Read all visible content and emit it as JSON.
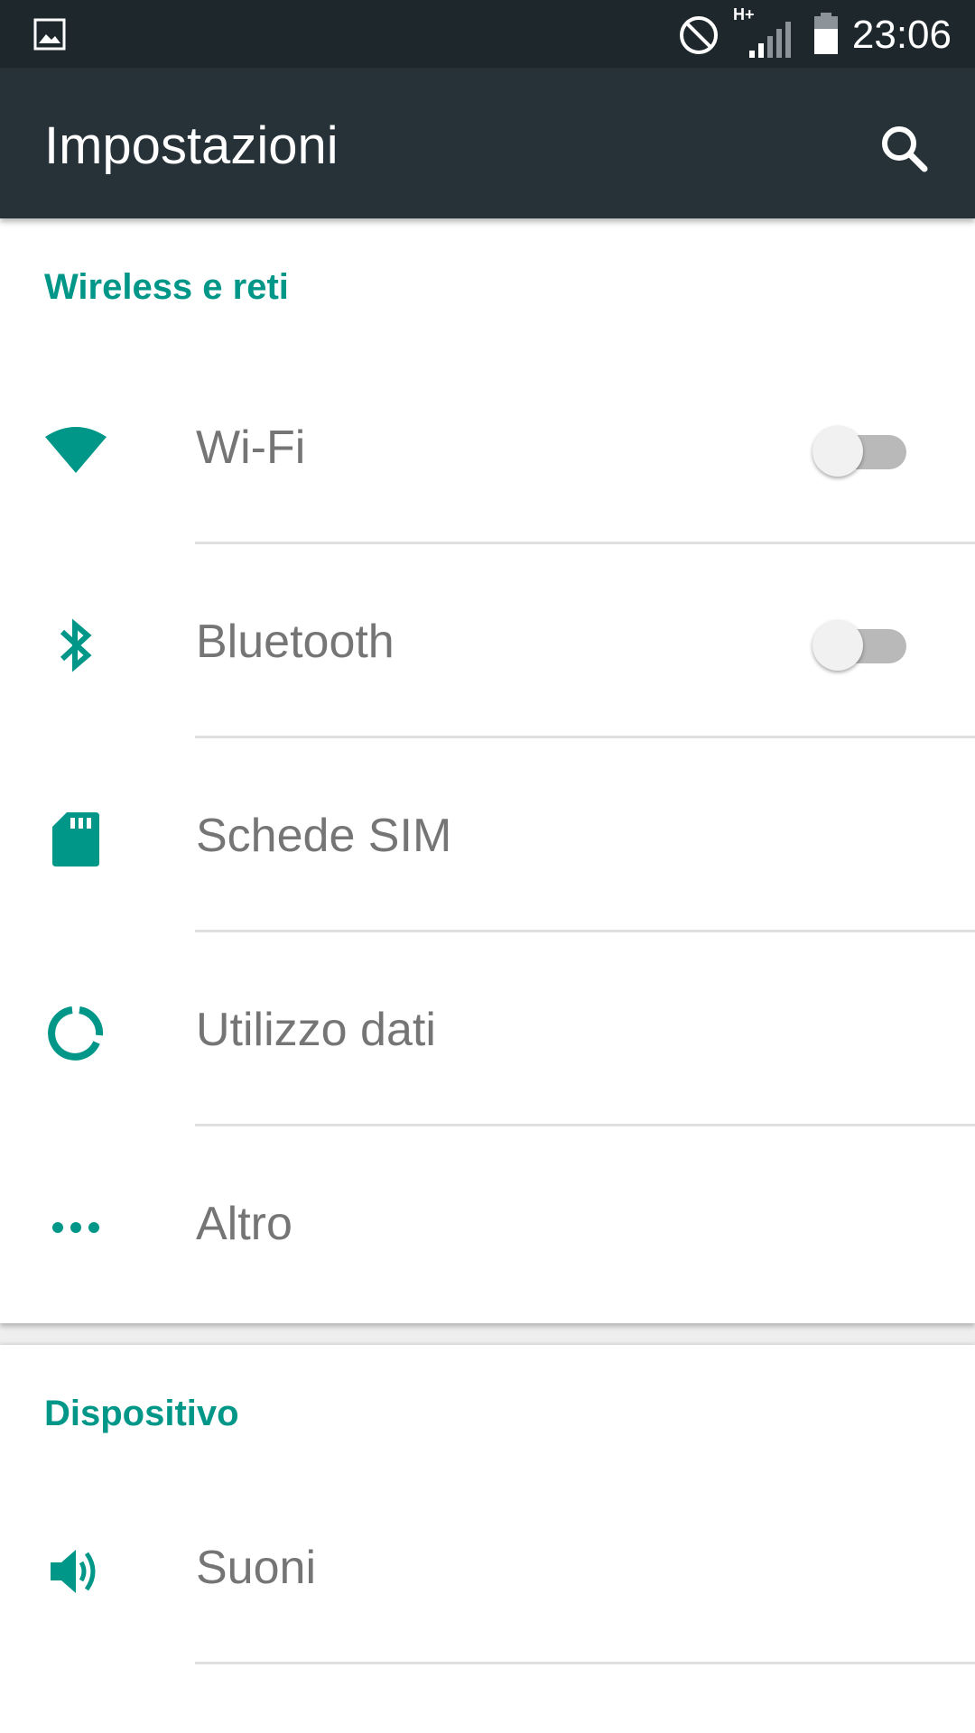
{
  "status_bar": {
    "time": "23:06",
    "network_label": "H+",
    "icons": [
      "gallery-icon",
      "do-not-disturb-icon",
      "signal-icon",
      "battery-icon"
    ]
  },
  "app_bar": {
    "title": "Impostazioni",
    "search_icon": "search-icon"
  },
  "colors": {
    "accent": "#009688",
    "app_bar": "#263238",
    "status_bar": "#1e272c",
    "label": "#757575",
    "divider": "#e0e0e0"
  },
  "sections": [
    {
      "header": "Wireless e reti",
      "items": [
        {
          "label": "Wi-Fi",
          "icon": "wifi-icon",
          "toggle": false
        },
        {
          "label": "Bluetooth",
          "icon": "bluetooth-icon",
          "toggle": false
        },
        {
          "label": "Schede SIM",
          "icon": "sim-card-icon"
        },
        {
          "label": "Utilizzo dati",
          "icon": "data-usage-icon"
        },
        {
          "label": "Altro",
          "icon": "more-icon"
        }
      ]
    },
    {
      "header": "Dispositivo",
      "items": [
        {
          "label": "Suoni",
          "icon": "volume-icon"
        }
      ]
    }
  ]
}
